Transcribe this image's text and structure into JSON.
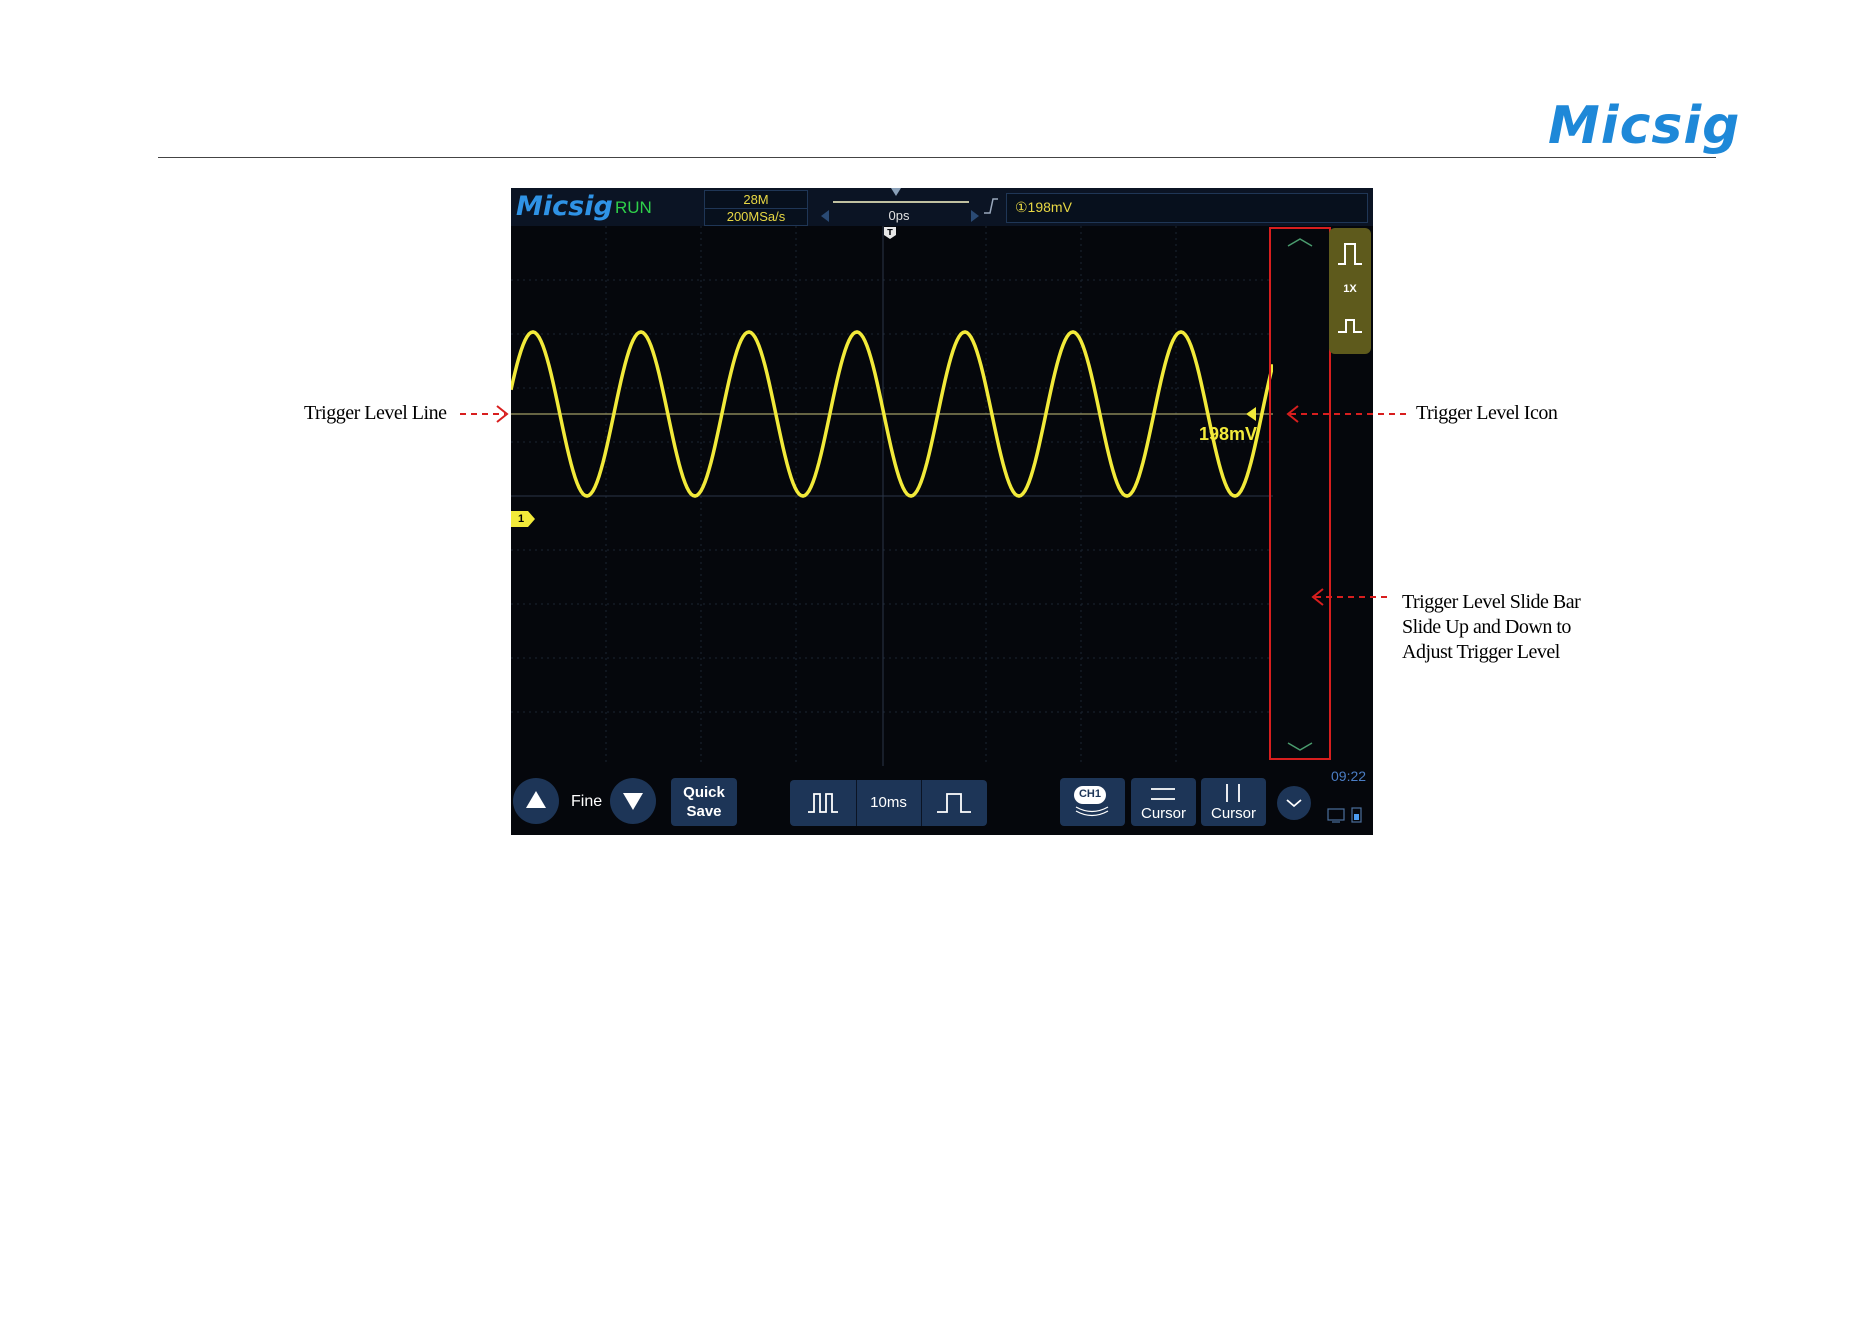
{
  "brand": {
    "logo_text": "Micsig",
    "color": "#1e88d8"
  },
  "scope": {
    "logo_text": "Micsig",
    "run_status": "RUN",
    "acquisition": {
      "memory_depth": "28M",
      "sample_rate": "200MSa/s"
    },
    "timebase_position": "0ps",
    "trigger_info": "①198mV",
    "trigger_position_marker": "T",
    "channel_marker": "1",
    "trigger_level_value": "198mV",
    "side_panel": {
      "zoom_label": "1X"
    },
    "time": "09:22",
    "bottom_bar": {
      "fine_label": "Fine",
      "quick_save_line1": "Quick",
      "quick_save_line2": "Save",
      "timebase_scale": "10ms",
      "ch1_label": "CH1",
      "cursor_horizontal_label": "Cursor",
      "cursor_vertical_label": "Cursor"
    },
    "colors": {
      "trace": "#f2ea3a",
      "run": "#2fd04a",
      "button": "#1d3557",
      "slide_bar_highlight": "#d81e1e"
    },
    "icons": [
      "trigger-rising-edge-icon",
      "arrow-up-icon",
      "arrow-down-icon",
      "pulse-wide-icon",
      "pulse-narrow-icon",
      "chevron-down-icon"
    ]
  },
  "annotations": {
    "trigger_level_line": "Trigger Level Line",
    "trigger_level_icon": "Trigger Level Icon",
    "slide_bar_line1": "Trigger Level Slide Bar",
    "slide_bar_line2": "Slide Up and Down to",
    "slide_bar_line3": "Adjust Trigger Level"
  }
}
